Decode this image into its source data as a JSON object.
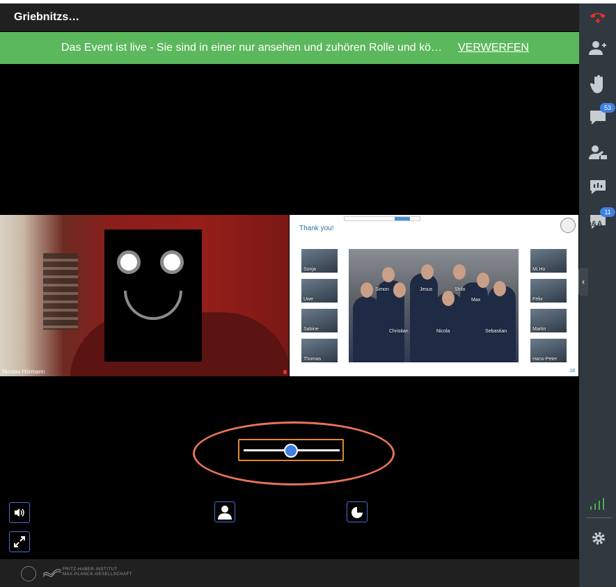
{
  "header": {
    "title": "Griebnitzs…"
  },
  "banner": {
    "message": "Das Event ist live - Sie sind in einer nur ansehen und zuhören Rolle und kö…",
    "dismiss_label": "VERWERFEN"
  },
  "camera": {
    "participant_name": "Nicolas Hörmann"
  },
  "slide": {
    "heading": "Thank you!",
    "page_number": "18",
    "left_thumbs": [
      "Sonja",
      "Uwe",
      "Sabine",
      "Thomas"
    ],
    "right_thumbs": [
      "Mi.Ho",
      "Felix",
      "Martin",
      "Hans-Peter"
    ],
    "group_names": [
      "Simon",
      "Jesus",
      "Shilo",
      "Max",
      "Christian",
      "Nicola",
      "Sebastian"
    ]
  },
  "controls": {
    "volume_icon": "speaker-icon",
    "fullscreen_icon": "expand-icon",
    "layout_left_icon": "person-icon",
    "layout_right_icon": "presentation-icon",
    "layout_slider_value": 0.5
  },
  "footer": {
    "org_line1": "FRITZ-HABER-INSTITUT",
    "org_line2": "MAX-PLANCK-GESELLSCHAFT"
  },
  "sidebar": {
    "items": [
      {
        "name": "leave-call",
        "icon": "phone-hangup-icon"
      },
      {
        "name": "participants",
        "icon": "users-icon"
      },
      {
        "name": "raise-hand",
        "icon": "hand-icon"
      },
      {
        "name": "chat",
        "icon": "chat-icon",
        "badge": "53"
      },
      {
        "name": "breakout",
        "icon": "presenter-icon"
      },
      {
        "name": "polls",
        "icon": "poll-icon"
      },
      {
        "name": "qa",
        "icon": "qa-icon",
        "label": "Q&A",
        "badge": "11"
      }
    ],
    "settings_icon": "gear-icon",
    "signal_icon": "signal-bars-icon"
  },
  "colors": {
    "banner": "#5cb85c",
    "accent": "#3f80e0",
    "hangup": "#e0302a",
    "highlight": "#e8735d",
    "signal": "#4caf50"
  }
}
